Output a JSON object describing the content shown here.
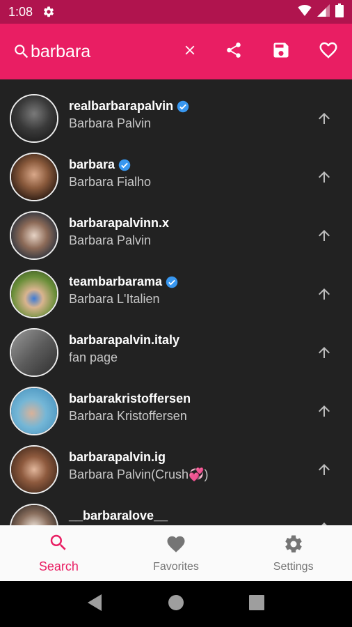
{
  "status_bar": {
    "time": "1:08"
  },
  "search": {
    "query": "barbara"
  },
  "results": [
    {
      "username": "realbarbarapalvin",
      "full_name": "Barbara Palvin",
      "verified": true
    },
    {
      "username": "barbara",
      "full_name": "Barbara Fialho",
      "verified": true
    },
    {
      "username": "barbarapalvinn.x",
      "full_name": "Barbara Palvin",
      "verified": false
    },
    {
      "username": "teambarbarama",
      "full_name": "Barbara L'Italien",
      "verified": true
    },
    {
      "username": "barbarapalvin.italy",
      "full_name": "fan page",
      "verified": false
    },
    {
      "username": "barbarakristoffersen",
      "full_name": "Barbara Kristoffersen",
      "verified": false
    },
    {
      "username": "barbarapalvin.ig",
      "full_name": "Barbara Palvin(Crush💞)",
      "verified": false
    },
    {
      "username": "__barbaralove__",
      "full_name": "",
      "verified": false
    }
  ],
  "bottom_nav": [
    {
      "label": "Search",
      "icon": "search-icon",
      "active": true
    },
    {
      "label": "Favorites",
      "icon": "heart-icon",
      "active": false
    },
    {
      "label": "Settings",
      "icon": "gear-icon",
      "active": false
    }
  ],
  "colors": {
    "primary": "#e91e63",
    "status_bar": "#b0144e",
    "background": "#222222",
    "verified": "#3897f0"
  }
}
